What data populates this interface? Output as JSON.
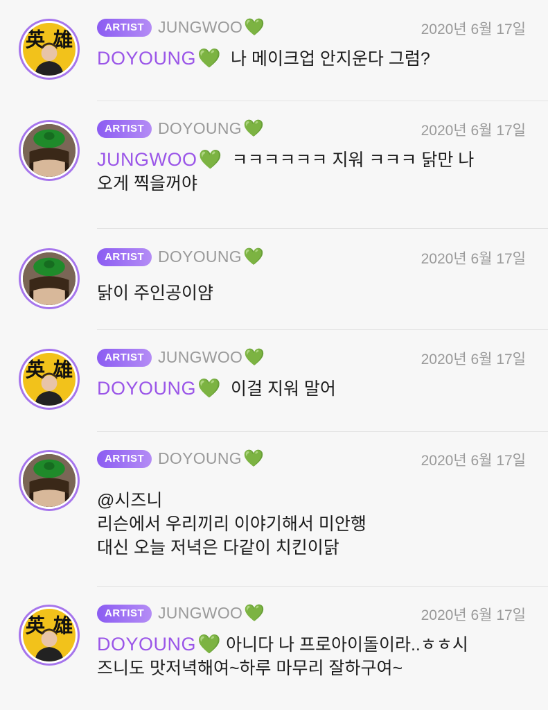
{
  "icons": {
    "heart": "💚"
  },
  "colors": {
    "accent": "#a675ec",
    "mention": "#9a55e8",
    "heart": "#3dbd3b",
    "muted": "#9a9a9a"
  },
  "posts": [
    {
      "avatar": "jungwoo-avatar",
      "badge": "ARTIST",
      "to": "JUNGWOO",
      "date": "2020년 6월 17일",
      "mention": "DOYOUNG",
      "lines": [
        "  나 메이크업 안지운다 그럼?"
      ]
    },
    {
      "avatar": "doyoung-avatar",
      "badge": "ARTIST",
      "to": "DOYOUNG",
      "date": "2020년 6월 17일",
      "mention": "JUNGWOO",
      "lines": [
        "  ㅋㅋㅋㅋㅋㅋ 지워 ㅋㅋㅋ 닭만 나",
        "오게 찍을꺼야"
      ]
    },
    {
      "avatar": "doyoung-avatar",
      "badge": "ARTIST",
      "to": "DOYOUNG",
      "date": "2020년 6월 17일",
      "lines": [
        "닭이 주인공이얌"
      ]
    },
    {
      "avatar": "jungwoo-avatar",
      "badge": "ARTIST",
      "to": "JUNGWOO",
      "date": "2020년 6월 17일",
      "mention": "DOYOUNG",
      "lines": [
        "  이걸 지워 말어"
      ]
    },
    {
      "avatar": "doyoung-avatar",
      "badge": "ARTIST",
      "to": "DOYOUNG",
      "date": "2020년 6월 17일",
      "lines": [
        "@시즈니",
        "리슨에서 우리끼리 이야기해서 미안행",
        "대신 오늘 저녁은 다같이 치킨이닭"
      ]
    },
    {
      "avatar": "jungwoo-avatar",
      "badge": "ARTIST",
      "to": "JUNGWOO",
      "date": "2020년 6월 17일",
      "mention": "DOYOUNG",
      "lines": [
        " 아니다 나 프로아이돌이라..ㅎㅎ시",
        "즈니도 맛저녁해여~하루 마무리 잘하구여~"
      ]
    }
  ]
}
